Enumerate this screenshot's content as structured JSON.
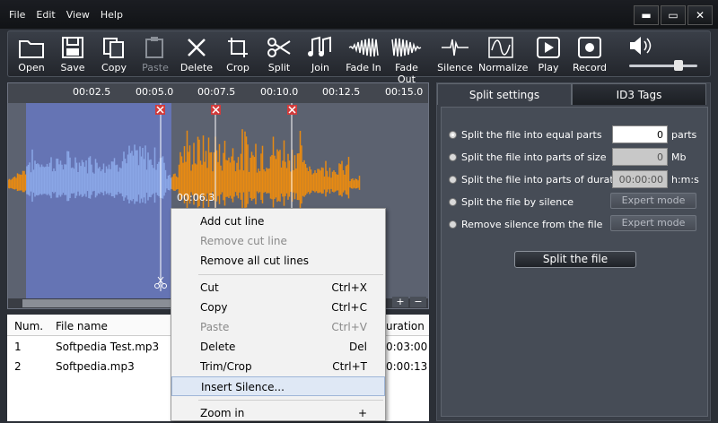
{
  "menu": [
    "File",
    "Edit",
    "View",
    "Help"
  ],
  "window_buttons": {
    "minimize": "▬",
    "maximize": "▭",
    "close": "✕"
  },
  "toolbar": [
    {
      "label": "Open",
      "icon": "folder-icon"
    },
    {
      "label": "Save",
      "icon": "floppy-icon"
    },
    {
      "label": "Copy",
      "icon": "copy-icon"
    },
    {
      "label": "Paste",
      "icon": "paste-icon",
      "disabled": true
    },
    {
      "label": "Delete",
      "icon": "delete-icon"
    },
    {
      "label": "Crop",
      "icon": "crop-icon"
    },
    {
      "label": "Split",
      "icon": "scissors-icon"
    },
    {
      "label": "Join",
      "icon": "join-icon"
    },
    {
      "label": "Fade In",
      "icon": "fade-in-icon"
    },
    {
      "label": "Fade Out",
      "icon": "fade-out-icon"
    },
    {
      "label": "Silence",
      "icon": "silence-icon"
    },
    {
      "label": "Normalize",
      "icon": "normalize-icon"
    },
    {
      "label": "Play",
      "icon": "play-icon"
    },
    {
      "label": "Record",
      "icon": "record-icon"
    }
  ],
  "volume": {
    "icon": "speaker-icon",
    "level": 0.75
  },
  "ruler": [
    "00:02.5",
    "00:05.0",
    "00:07.5",
    "00:10.0",
    "00:12.5",
    "00:15.0"
  ],
  "cursor_time": "00:06.3",
  "zoom_buttons": [
    "+",
    "−"
  ],
  "file_list": {
    "headers": {
      "num": "Num.",
      "name": "File name",
      "duration": "uration"
    },
    "rows": [
      {
        "num": "1",
        "name": "Softpedia Test.mp3",
        "duration": "0:03:00"
      },
      {
        "num": "2",
        "name": "Softpedia.mp3",
        "duration": "0:00:13"
      }
    ]
  },
  "tabs": {
    "split": "Split settings",
    "id3": "ID3 Tags"
  },
  "split": {
    "opt_equal": "Split the file into equal parts",
    "equal_value": "0",
    "equal_unit": "parts",
    "opt_size": "Split the file into parts of size",
    "size_value": "0",
    "size_unit": "Mb",
    "opt_duration": "Split the file into parts of duration",
    "duration_value": "00:00:00",
    "duration_unit": "h:m:s",
    "opt_silence": "Split the file by silence",
    "opt_remove": "Remove silence from the file",
    "expert": "Expert mode",
    "button": "Split the file"
  },
  "context_menu": {
    "add_cut": "Add cut line",
    "remove_cut": "Remove cut line",
    "remove_all": "Remove all cut lines",
    "cut": "Cut",
    "cut_key": "Ctrl+X",
    "copy": "Copy",
    "copy_key": "Ctrl+C",
    "paste": "Paste",
    "paste_key": "Ctrl+V",
    "delete": "Delete",
    "delete_key": "Del",
    "trim": "Trim/Crop",
    "trim_key": "Ctrl+T",
    "insert": "Insert Silence...",
    "zoom": "Zoom in",
    "zoom_key": "+"
  },
  "colors": {
    "selection": "#6574b4",
    "wave_selected": "#8aa6e6",
    "wave_unselected": "#e88a12",
    "cut_marker": "#d23b3b"
  }
}
